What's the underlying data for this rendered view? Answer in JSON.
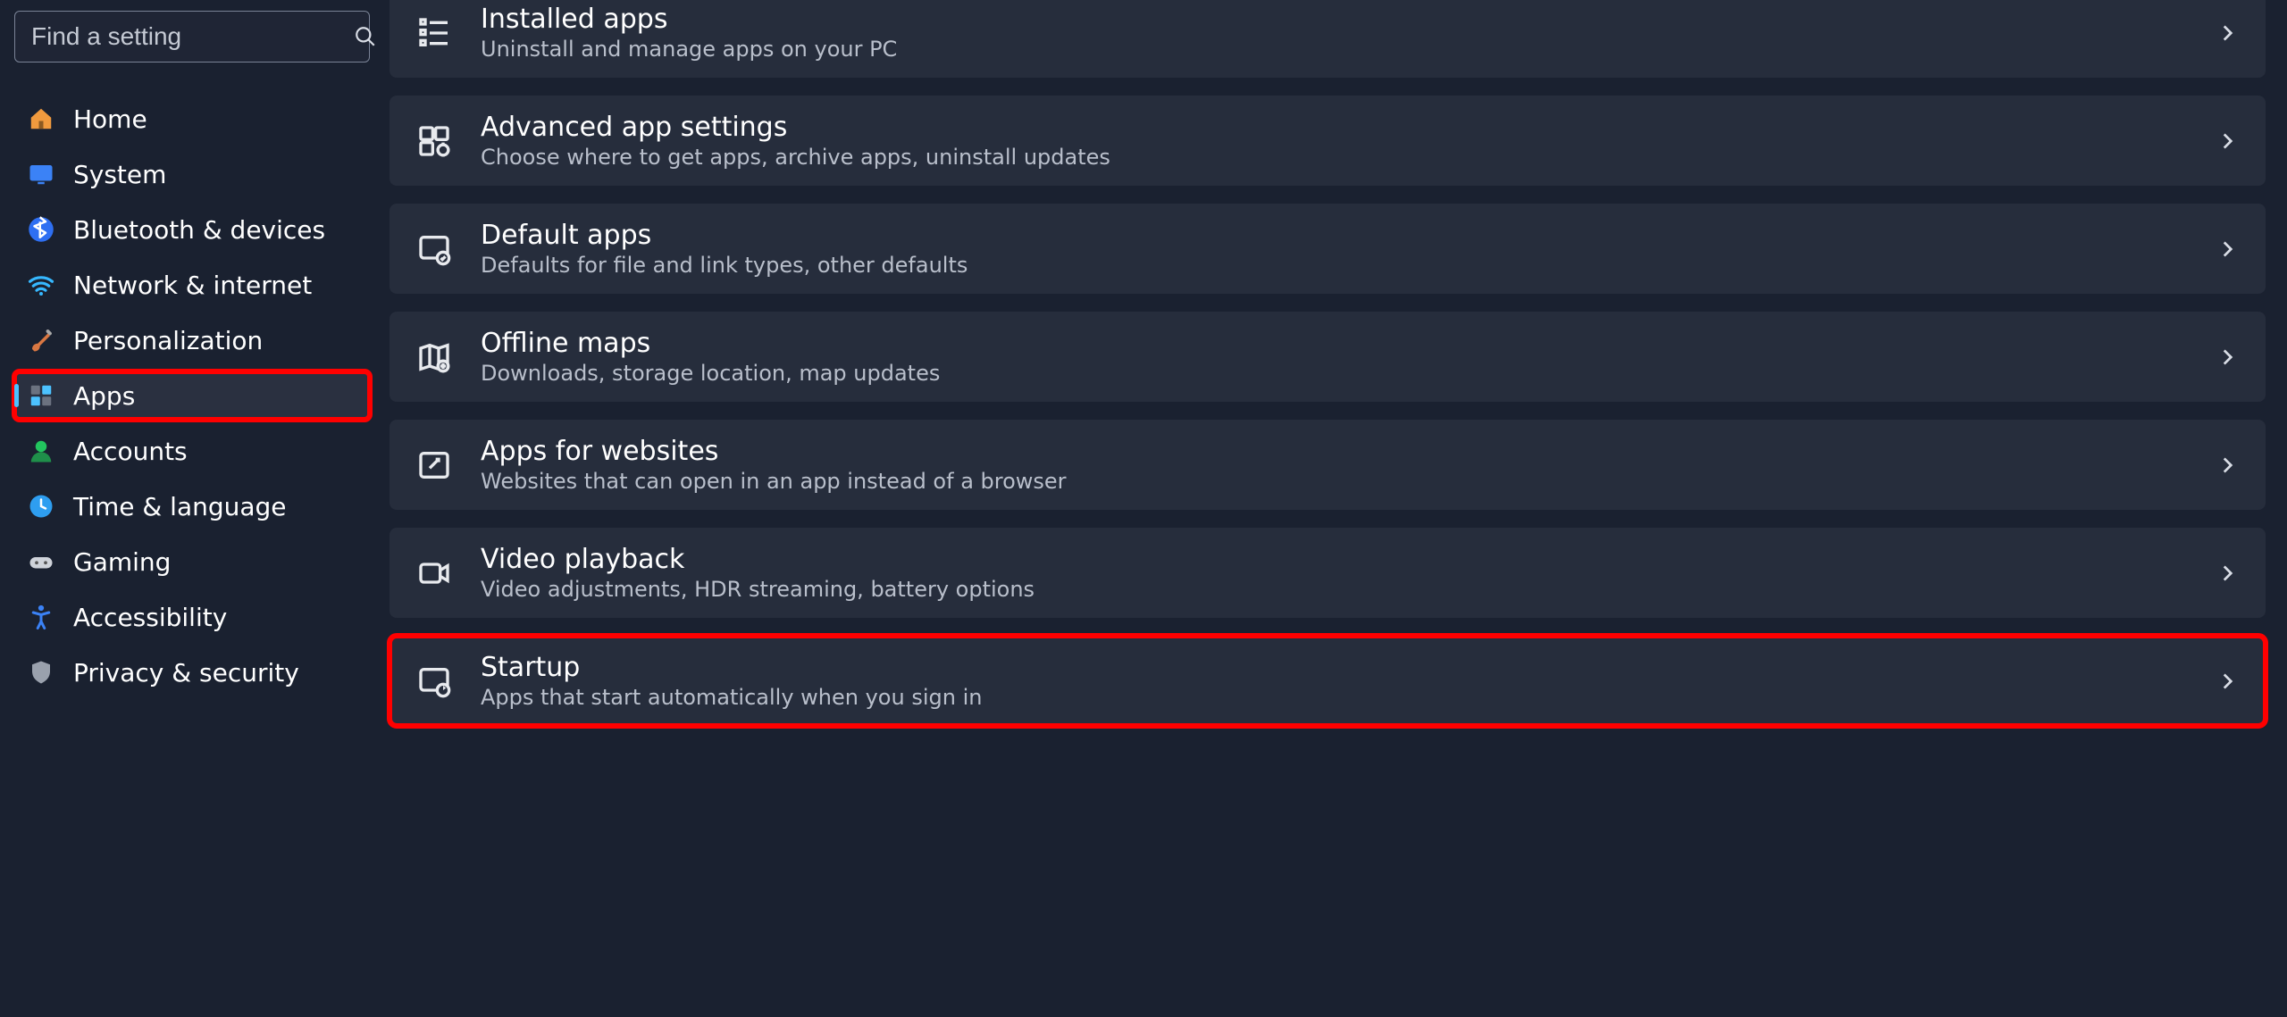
{
  "search": {
    "placeholder": "Find a setting"
  },
  "sidebar": {
    "items": [
      {
        "label": "Home",
        "icon": "home",
        "active": false,
        "highlighted": false
      },
      {
        "label": "System",
        "icon": "system",
        "active": false,
        "highlighted": false
      },
      {
        "label": "Bluetooth & devices",
        "icon": "bluetooth",
        "active": false,
        "highlighted": false
      },
      {
        "label": "Network & internet",
        "icon": "wifi",
        "active": false,
        "highlighted": false
      },
      {
        "label": "Personalization",
        "icon": "brush",
        "active": false,
        "highlighted": false
      },
      {
        "label": "Apps",
        "icon": "apps",
        "active": true,
        "highlighted": true
      },
      {
        "label": "Accounts",
        "icon": "person",
        "active": false,
        "highlighted": false
      },
      {
        "label": "Time & language",
        "icon": "clock",
        "active": false,
        "highlighted": false
      },
      {
        "label": "Gaming",
        "icon": "gamepad",
        "active": false,
        "highlighted": false
      },
      {
        "label": "Accessibility",
        "icon": "accessibility",
        "active": false,
        "highlighted": false
      },
      {
        "label": "Privacy & security",
        "icon": "shield",
        "active": false,
        "highlighted": false
      }
    ]
  },
  "main": {
    "cards": [
      {
        "title": "Installed apps",
        "sub": "Uninstall and manage apps on your PC",
        "icon": "list",
        "highlighted": false,
        "first": true
      },
      {
        "title": "Advanced app settings",
        "sub": "Choose where to get apps, archive apps, uninstall updates",
        "icon": "apps-gear",
        "highlighted": false
      },
      {
        "title": "Default apps",
        "sub": "Defaults for file and link types, other defaults",
        "icon": "default-apps",
        "highlighted": false
      },
      {
        "title": "Offline maps",
        "sub": "Downloads, storage location, map updates",
        "icon": "map",
        "highlighted": false
      },
      {
        "title": "Apps for websites",
        "sub": "Websites that can open in an app instead of a browser",
        "icon": "link-app",
        "highlighted": false
      },
      {
        "title": "Video playback",
        "sub": "Video adjustments, HDR streaming, battery options",
        "icon": "video",
        "highlighted": false
      },
      {
        "title": "Startup",
        "sub": "Apps that start automatically when you sign in",
        "icon": "startup",
        "highlighted": true
      }
    ]
  },
  "highlight_color": "#ff0000",
  "accent_color": "#4cc2ff"
}
